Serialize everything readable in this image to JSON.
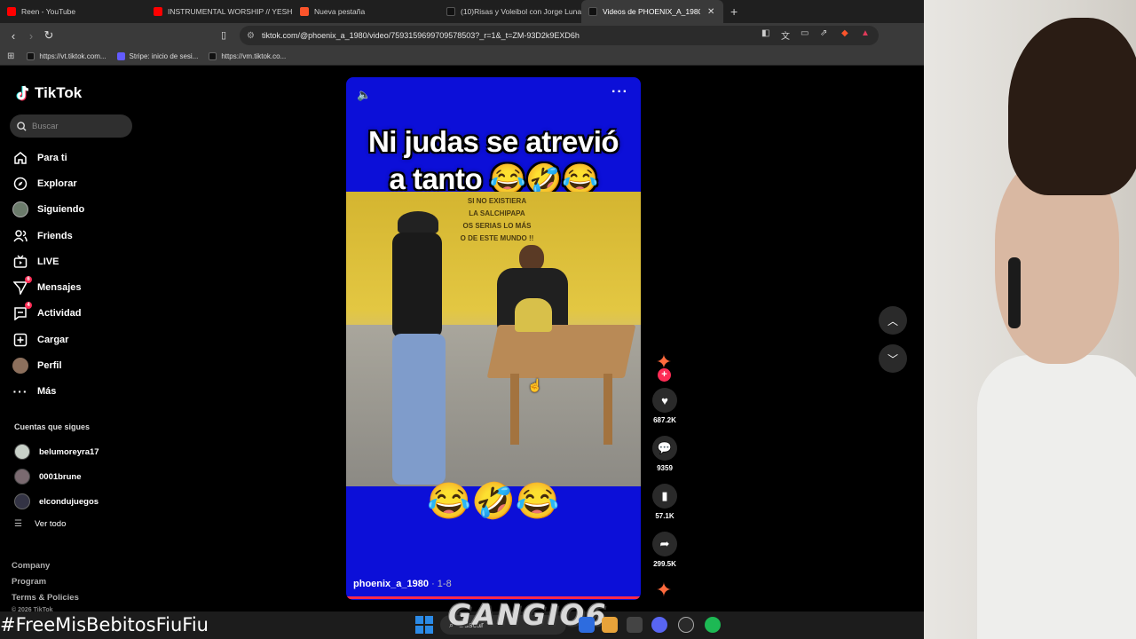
{
  "browser": {
    "tabs": [
      {
        "label": "Reen - YouTube",
        "fav": "#ff0000"
      },
      {
        "label": "INSTRUMENTAL WORSHIP // YESHU",
        "fav": "#ff0000"
      },
      {
        "label": "Nueva pestaña",
        "fav": "#fb542b"
      },
      {
        "label": "(10)Risas y Voleibol con Jorge Luna y",
        "fav": "#111111"
      },
      {
        "label": "Videos de PHOENIX_A_1980",
        "fav": "#111111"
      }
    ],
    "url": "tiktok.com/@phoenix_a_1980/video/7593159699709578503?_r=1&_t=ZM-93D2k9EXD6h",
    "bookmarks": [
      "https://vt.tiktok.com...",
      "Stripe: inicio de sesi...",
      "https://vm.tiktok.co..."
    ]
  },
  "tiktok": {
    "logo": "TikTok",
    "search_placeholder": "Buscar",
    "nav": [
      {
        "label": "Para ti",
        "icon": "home-icon"
      },
      {
        "label": "Explorar",
        "icon": "compass-icon"
      },
      {
        "label": "Siguiendo",
        "icon": "avatar-icon"
      },
      {
        "label": "Friends",
        "icon": "friends-icon"
      },
      {
        "label": "LIVE",
        "icon": "live-icon"
      },
      {
        "label": "Mensajes",
        "icon": "message-icon",
        "badge": "6"
      },
      {
        "label": "Actividad",
        "icon": "activity-icon",
        "badge": "4"
      },
      {
        "label": "Cargar",
        "icon": "upload-icon"
      },
      {
        "label": "Perfil",
        "icon": "profile-icon"
      },
      {
        "label": "Más",
        "icon": "more-icon"
      }
    ],
    "following_header": "Cuentas que sigues",
    "following": [
      "belumoreyra17",
      "0001brune",
      "elcondujuegos"
    ],
    "see_all": "Ver todo",
    "footer": [
      "Company",
      "Program",
      "Terms & Policies"
    ],
    "copyright": "© 2026 TikTok"
  },
  "video": {
    "caption_line1": "Ni judas se atrevió",
    "caption_line2": "a tanto 😂🤣😂",
    "sign_lines": [
      "SI NO EXISTIERA",
      "LA SALCHIPAPA",
      "OS SERIAS LO MÁS",
      "O DE ESTE MUNDO !!"
    ],
    "bottom_emojis": "😂🤣😂",
    "author": "phoenix_a_1980",
    "date": "1-8"
  },
  "actions": {
    "likes": "687.2K",
    "comments": "9359",
    "saves": "57.1K",
    "shares": "299.5K"
  },
  "overlay": {
    "hashtag": "#FreeMisBebitosFiuFiu",
    "watermark": "GANGIO6",
    "taskbar_search": "Buscar"
  }
}
